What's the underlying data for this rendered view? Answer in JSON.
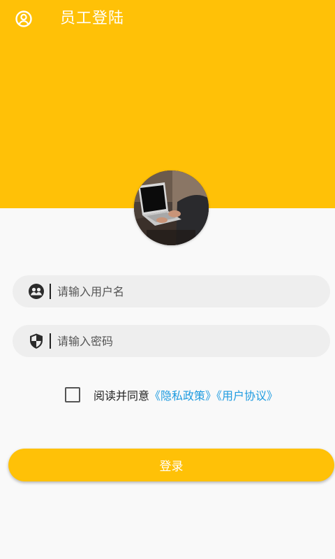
{
  "header": {
    "title": "员工登陆",
    "account_icon": "account-circle-icon",
    "color": "#ffc107"
  },
  "avatar": {
    "description_icon": "laptop-photo"
  },
  "form": {
    "username": {
      "placeholder": "请输入用户名",
      "value": "",
      "icon": "user-group-icon"
    },
    "password": {
      "placeholder": "请输入密码",
      "value": "",
      "icon": "shield-icon"
    }
  },
  "agreement": {
    "checked": false,
    "text": "阅读并同意",
    "privacy_link": "《隐私政策》",
    "terms_link": "《用户协议》",
    "link_color": "#1e9be0"
  },
  "login_button": {
    "label": "登录"
  }
}
